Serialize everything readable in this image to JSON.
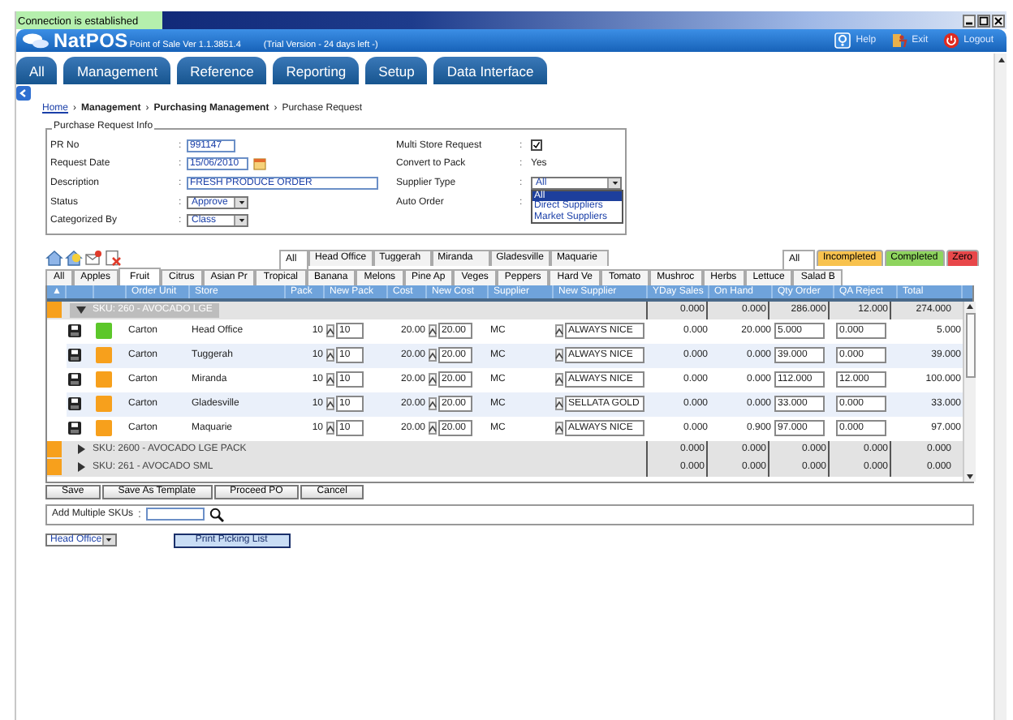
{
  "window": {
    "notice": "Connection is established"
  },
  "header": {
    "logo": "NatPOS",
    "version": "Point of Sale Ver 1.1.3851.4",
    "trial": "(Trial Version - 24 days left -)",
    "actions": [
      {
        "kind": "help",
        "label": "Help"
      },
      {
        "kind": "exit",
        "label": "Exit"
      },
      {
        "kind": "logout",
        "label": "Logout"
      }
    ]
  },
  "main_tabs": [
    {
      "label": "All",
      "selected": false
    },
    {
      "label": "Management",
      "selected": false
    },
    {
      "label": "Reference",
      "selected": false
    },
    {
      "label": "Reporting",
      "selected": false
    },
    {
      "label": "Setup",
      "selected": false
    },
    {
      "label": "Data Interface",
      "selected": false
    }
  ],
  "breadcrumb": [
    {
      "kind": "link",
      "label": "Home"
    },
    {
      "kind": "separator",
      "label": "›"
    },
    {
      "kind": "bold",
      "label": "Management"
    },
    {
      "kind": "separator",
      "label": "›"
    },
    {
      "kind": "bold",
      "label": "Purchasing Management"
    },
    {
      "kind": "separator",
      "label": "›"
    },
    {
      "kind": "current",
      "label": "Purchase Request"
    }
  ],
  "form": {
    "legend": "Purchase Request Info",
    "left_fields": [
      {
        "kind": "text",
        "label": "PR No",
        "colon": ":",
        "value": "991147"
      },
      {
        "kind": "date",
        "label": "Request Date",
        "colon": ":",
        "value": "15/06/2010"
      },
      {
        "kind": "long_text",
        "label": "Description",
        "colon": ":",
        "value": "FRESH PRODUCE ORDER"
      },
      {
        "kind": "select",
        "label": "Status",
        "colon": ":",
        "value": "Approve"
      },
      {
        "kind": "select",
        "label": "Categorized By",
        "colon": ":",
        "value": "Class"
      }
    ],
    "right_fields": [
      {
        "kind": "checkbox",
        "label": "Multi Store Request",
        "colon": ":",
        "checked": true
      },
      {
        "kind": "value",
        "label": "Convert to Pack",
        "colon": ":",
        "value": "Yes"
      },
      {
        "kind": "select",
        "label": "Supplier Type",
        "colon": ":",
        "value": "All",
        "options": [
          {
            "label": "All",
            "selected": true
          },
          {
            "label": "Direct Suppliers",
            "selected": false
          },
          {
            "label": "Market Suppliers",
            "selected": false
          }
        ]
      },
      {
        "kind": "empty",
        "label": "Auto Order",
        "colon": ":"
      }
    ]
  },
  "store_tabs": [
    {
      "label": "All",
      "selected": true
    },
    {
      "label": "Head Office",
      "selected": false
    },
    {
      "label": "Tuggerah",
      "selected": false
    },
    {
      "label": "Miranda",
      "selected": false
    },
    {
      "label": "Gladesville",
      "selected": false
    },
    {
      "label": "Maquarie",
      "selected": false
    }
  ],
  "status_tabs": [
    {
      "label": "All",
      "selected": true
    },
    {
      "label": "Incompleted",
      "selected": false,
      "color": "#f8c24e"
    },
    {
      "label": "Completed",
      "selected": false,
      "color": "#8ed45e"
    },
    {
      "label": "Zero",
      "selected": false,
      "color": "#e8474a"
    }
  ],
  "category_tabs": [
    {
      "label": "All",
      "selected": false
    },
    {
      "label": "Apples",
      "selected": false
    },
    {
      "label": "Fruit",
      "selected": true
    },
    {
      "label": "Citrus",
      "selected": false
    },
    {
      "label": "Asian Pr",
      "selected": false
    },
    {
      "label": "Tropical",
      "selected": false
    },
    {
      "label": "Banana",
      "selected": false
    },
    {
      "label": "Melons",
      "selected": false
    },
    {
      "label": "Pine Ap",
      "selected": false
    },
    {
      "label": "Veges",
      "selected": false
    },
    {
      "label": "Peppers",
      "selected": false
    },
    {
      "label": "Hard Ve",
      "selected": false
    },
    {
      "label": "Tomato",
      "selected": false
    },
    {
      "label": "Mushroc",
      "selected": false
    },
    {
      "label": "Herbs",
      "selected": false
    },
    {
      "label": "Lettuce",
      "selected": false
    },
    {
      "label": "Salad B",
      "selected": false
    }
  ],
  "table": {
    "sort_indicator": "▲",
    "columns": [
      "Order Unit",
      "Store",
      "Pack",
      "New Pack",
      "Cost",
      "New Cost",
      "Supplier",
      "New Supplier",
      "YDay Sales",
      "On Hand",
      "Qty Order",
      "QA Reject",
      "Total"
    ],
    "groups": [
      {
        "sku": "SKU: 260 - AVOCADO LGE",
        "expanded": true,
        "totals": [
          "0.000",
          "0.000",
          "286.000",
          "12.000",
          "274.000"
        ],
        "rows": [
          {
            "order_unit": "Carton",
            "store": "Head Office",
            "pack": "10",
            "new_pack": "10",
            "cost": "20.00",
            "new_cost": "20.00",
            "supplier": "MC",
            "new_supplier": "ALWAYS NICE",
            "yday_sales": "0.000",
            "on_hand": "20.000",
            "qty_order": "5.000",
            "qa_reject": "0.000",
            "total": "5.000",
            "color": "#5cc72a"
          },
          {
            "order_unit": "Carton",
            "store": "Tuggerah",
            "pack": "10",
            "new_pack": "10",
            "cost": "20.00",
            "new_cost": "20.00",
            "supplier": "MC",
            "new_supplier": "ALWAYS NICE",
            "yday_sales": "0.000",
            "on_hand": "0.000",
            "qty_order": "39.000",
            "qa_reject": "0.000",
            "total": "39.000",
            "color": "#f7a01c"
          },
          {
            "order_unit": "Carton",
            "store": "Miranda",
            "pack": "10",
            "new_pack": "10",
            "cost": "20.00",
            "new_cost": "20.00",
            "supplier": "MC",
            "new_supplier": "ALWAYS NICE",
            "yday_sales": "0.000",
            "on_hand": "0.000",
            "qty_order": "112.000",
            "qa_reject": "12.000",
            "total": "100.000",
            "color": "#f7a01c"
          },
          {
            "order_unit": "Carton",
            "store": "Gladesville",
            "pack": "10",
            "new_pack": "10",
            "cost": "20.00",
            "new_cost": "20.00",
            "supplier": "MC",
            "new_supplier": "SELLATA GOLD",
            "yday_sales": "0.000",
            "on_hand": "0.000",
            "qty_order": "33.000",
            "qa_reject": "0.000",
            "total": "33.000",
            "color": "#f7a01c"
          },
          {
            "order_unit": "Carton",
            "store": "Maquarie",
            "pack": "10",
            "new_pack": "10",
            "cost": "20.00",
            "new_cost": "20.00",
            "supplier": "MC",
            "new_supplier": "ALWAYS NICE",
            "yday_sales": "0.000",
            "on_hand": "0.900",
            "qty_order": "97.000",
            "qa_reject": "0.000",
            "total": "97.000",
            "color": "#f7a01c"
          }
        ]
      },
      {
        "sku": "SKU: 2600 - AVOCADO LGE PACK",
        "expanded": false,
        "totals": [
          "0.000",
          "0.000",
          "0.000",
          "0.000",
          "0.000"
        ]
      },
      {
        "sku": "SKU: 261 - AVOCADO SML",
        "expanded": false,
        "totals": [
          "0.000",
          "0.000",
          "0.000",
          "0.000",
          "0.000"
        ]
      }
    ]
  },
  "actions": [
    "Save",
    "Save As Template",
    "Proceed PO",
    "Cancel"
  ],
  "add_skus": {
    "label": "Add Multiple SKUs",
    "colon": ":"
  },
  "footer": {
    "store": "Head Office",
    "button": "Print Picking List"
  }
}
